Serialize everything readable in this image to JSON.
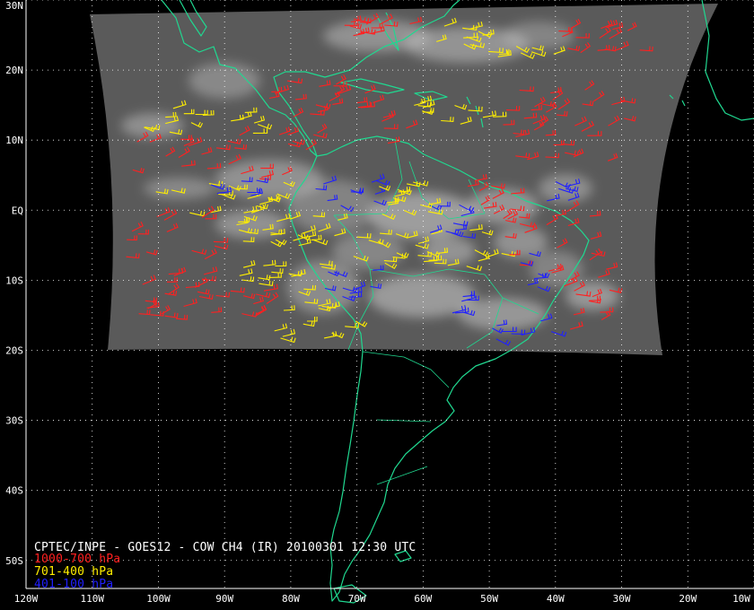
{
  "map": {
    "title": "CPTEC/INPE - GOES12 - COW CH4 (IR) 20100301 12:30 UTC",
    "legend": [
      {
        "label": "1000-700 hPa",
        "color": "#ff2020"
      },
      {
        "label": "701-400 hPa",
        "color": "#ffee00"
      },
      {
        "label": "401-100 hPa",
        "color": "#2020ff"
      }
    ],
    "colors": {
      "background": "#000000",
      "coastline": "#20d890",
      "gridline": "#ffffff",
      "satellite_image": "#5a5a5a",
      "clouds": "#c8c8c8"
    },
    "lat_labels": [
      "30N",
      "20N",
      "10N",
      "EQ",
      "10S",
      "20S",
      "30S",
      "40S",
      "50S"
    ],
    "lon_labels": [
      "120W",
      "110W",
      "100W",
      "90W",
      "80W",
      "70W",
      "60W",
      "50W",
      "40W",
      "30W",
      "20W",
      "10W"
    ],
    "extent": {
      "lon_min": -120,
      "lon_max": -10,
      "lat_min": -54,
      "lat_max": 30
    }
  }
}
